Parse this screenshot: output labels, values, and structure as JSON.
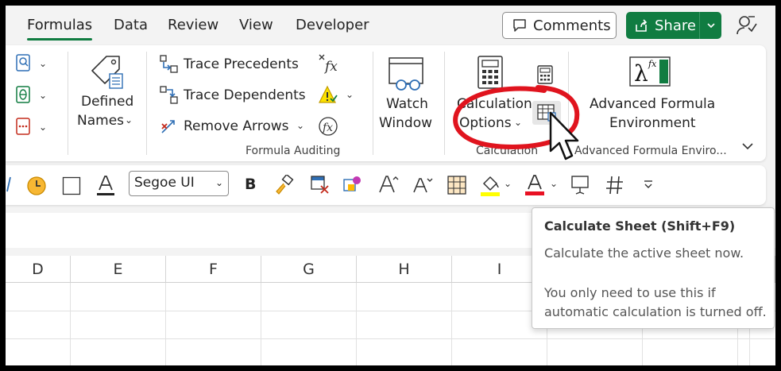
{
  "tabs": [
    "Formulas",
    "Data",
    "Review",
    "View",
    "Developer"
  ],
  "actions": {
    "comments": "Comments",
    "share": "Share"
  },
  "ribbon": {
    "defined_names": {
      "line1": "Defined",
      "line2": "Names"
    },
    "auditing": {
      "trace_precedents": "Trace Precedents",
      "trace_dependents": "Trace Dependents",
      "remove_arrows": "Remove Arrows",
      "group_label": "Formula Auditing"
    },
    "watch_window": {
      "line1": "Watch",
      "line2": "Window"
    },
    "calculation": {
      "line1": "Calculation",
      "line2": "Options",
      "group_label": "Calculation"
    },
    "advanced": {
      "line1": "Advanced Formula",
      "line2": "Environment",
      "group_label": "Advanced Formula Enviro..."
    }
  },
  "format_bar": {
    "font": "Segoe UI",
    "bold": "B"
  },
  "columns": [
    "D",
    "E",
    "F",
    "G",
    "H",
    "I"
  ],
  "tooltip": {
    "title": "Calculate Sheet (Shift+F9)",
    "description": "Calculate the active sheet now.",
    "note": "You only need to use this if automatic calculation is turned off."
  },
  "colors": {
    "accent": "#107c41",
    "annotation": "#e0141e",
    "highlight": "#ffff00",
    "font_color": "#e81123"
  }
}
